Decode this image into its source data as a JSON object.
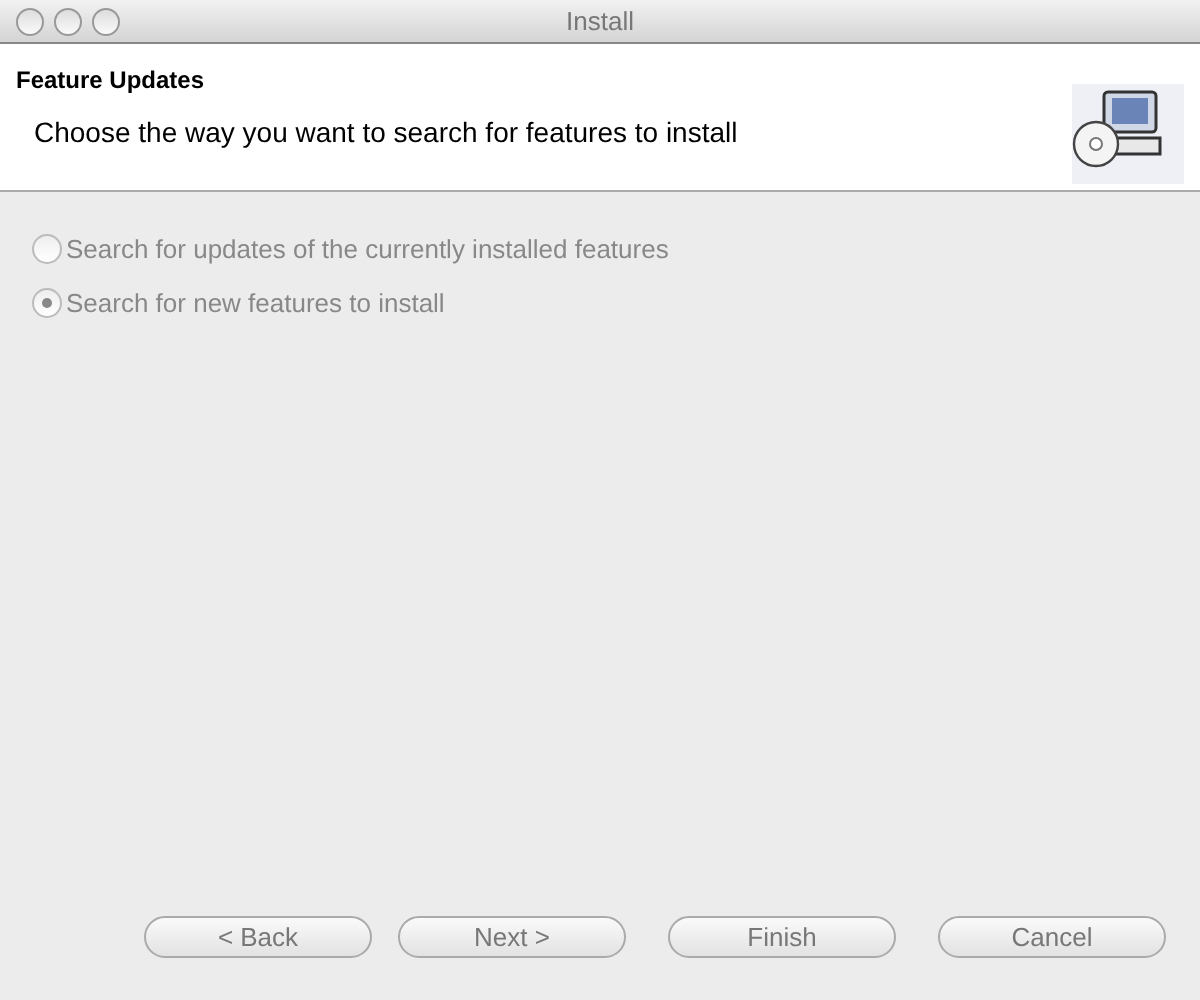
{
  "window": {
    "title": "Install"
  },
  "header": {
    "title": "Feature Updates",
    "description": "Choose the way you want to search for features to install"
  },
  "options": [
    {
      "label": "Search for updates of the currently installed features",
      "selected": false,
      "disabled": true
    },
    {
      "label": "Search for new features to install",
      "selected": true,
      "disabled": true
    }
  ],
  "buttons": [
    {
      "label": "< Back",
      "disabled": true
    },
    {
      "label": "Next >",
      "disabled": true
    },
    {
      "label": "Finish",
      "disabled": true
    },
    {
      "label": "Cancel",
      "disabled": true
    }
  ]
}
